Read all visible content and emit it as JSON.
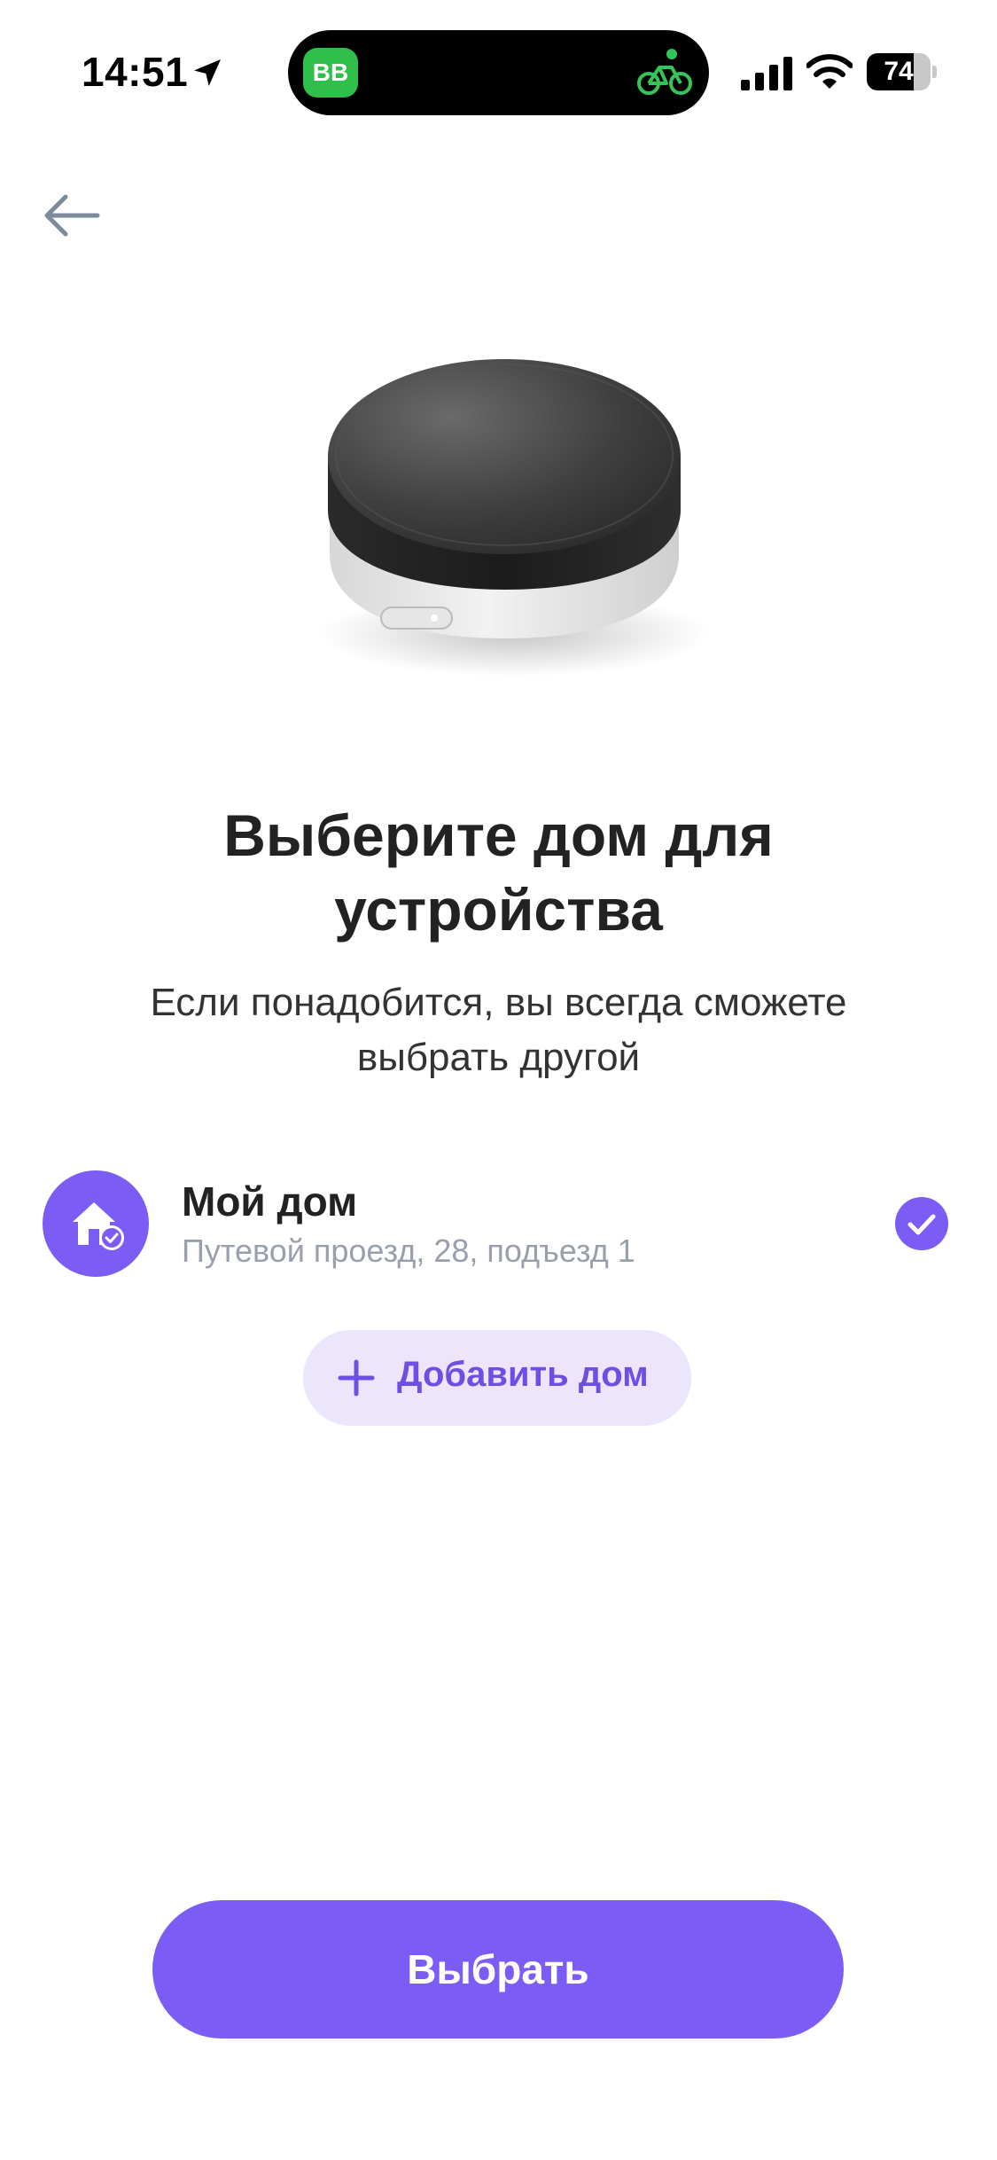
{
  "status_bar": {
    "time": "14:51",
    "battery_level": "74",
    "battery_fraction": 0.74,
    "badge_text": "BB",
    "icons": [
      "location-arrow-icon",
      "bicycle-icon",
      "cellular-signal-icon",
      "wifi-icon",
      "battery-icon"
    ]
  },
  "header": {
    "back_icon": "arrow-left-icon"
  },
  "main": {
    "title": "Выберите дом для устройства",
    "subtitle": "Если понадобится, вы всегда сможете выбрать другой"
  },
  "homes": [
    {
      "name": "Мой дом",
      "address": "Путевой проезд, 28, подъезд 1",
      "selected": true,
      "icon": "house-check-icon"
    }
  ],
  "add_home": {
    "label": "Добавить дом",
    "icon": "plus-icon"
  },
  "footer": {
    "choose_label": "Выбрать"
  },
  "colors": {
    "accent": "#7b5cf5",
    "accent_light": "#ece6fd",
    "accent_text": "#6e4fe6",
    "badge_green": "#2fbf4a"
  }
}
